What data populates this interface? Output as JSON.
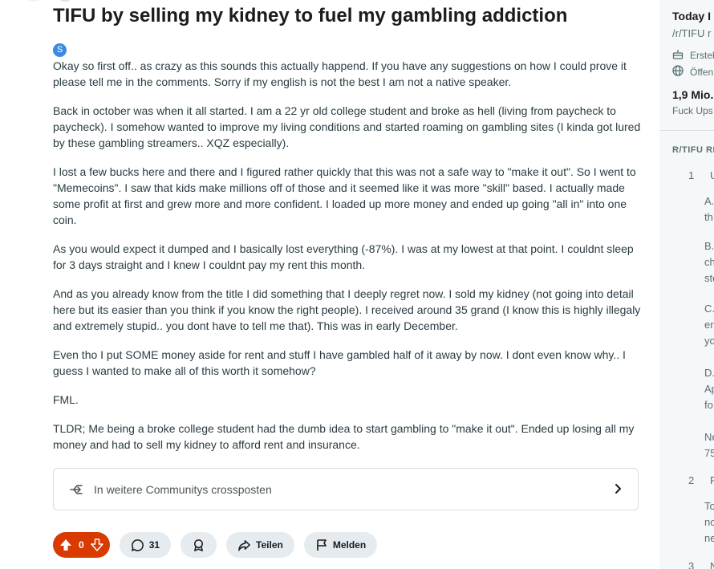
{
  "post": {
    "title": "TIFU by selling my kidney to fuel my gambling addiction",
    "flair": "S",
    "paragraphs": [
      "Okay so first off.. as crazy as this sounds this actually happend. If you have any suggestions on how I could prove it please tell me in the comments. Sorry if my english is not the best I am not a native speaker.",
      "Back in october was when it all started. I am a 22 yr old college student and broke as hell (living from paycheck to paycheck). I somehow wanted to improve my living conditions and started roaming on gambling sites (I kinda got lured by these gambling streamers.. XQZ especially).",
      "I lost a few bucks here and there and I figured rather quickly that this was not a safe way to \"make it out\". So I went to \"Memecoins\". I saw that kids make millions off of those and it seemed like it was more \"skill\" based. I actually made some profit at first and grew more and more confident. I loaded up more money and ended up going \"all in\" into one coin.",
      "As you would expect it dumped and I basically lost everything (-87%). I was at my lowest at that point. I couldnt sleep for 3 days straight and I knew I couldnt pay my rent this month.",
      "And as you already know from the title I did something that I deeply regret now. I sold my kidney (not going into detail here but its easier than you think if you know the right people). I received around 35 grand (I know this is highly illegaly and extremely stupid.. you dont have to tell me that). This was in early December.",
      "Even tho I put SOME money aside for rent and stuff I have gambled half of it away by now. I dont even know why.. I guess I wanted to make all of this worth it somehow?",
      "FML.",
      "TLDR; Me being a broke college student had the dumb idea to start gambling to \"make it out\". Ended up losing all my money and had to sell my kidney to afford rent and insurance."
    ]
  },
  "crosspost": {
    "label": "In weitere Communitys crossposten"
  },
  "actions": {
    "votes": "0",
    "comments": "31",
    "share": "Teilen",
    "report": "Melden"
  },
  "sidebar": {
    "title": "Today I",
    "subreddit": "/r/TIFU r",
    "created": "Erstel",
    "visibility": "Öffen",
    "members": "1,9 Mio.",
    "members_label": "Fuck Ups",
    "rules_heading": "R/TIFU RE",
    "rules": [
      {
        "num": "1",
        "title": "U",
        "fragments": [
          "A.",
          "th",
          "B.",
          "ch",
          "ste",
          "C.",
          "en",
          "yo",
          "D.",
          "Ap",
          "fo",
          "Ne",
          "75"
        ]
      },
      {
        "num": "2",
        "title": "F",
        "fragments": [
          "To",
          "no",
          "ne"
        ]
      },
      {
        "num": "3",
        "title": "N"
      }
    ]
  },
  "colors": {
    "upvote": "#d93a00",
    "pill": "#e5ebee",
    "sidebar_bg": "#f6f7f8"
  }
}
